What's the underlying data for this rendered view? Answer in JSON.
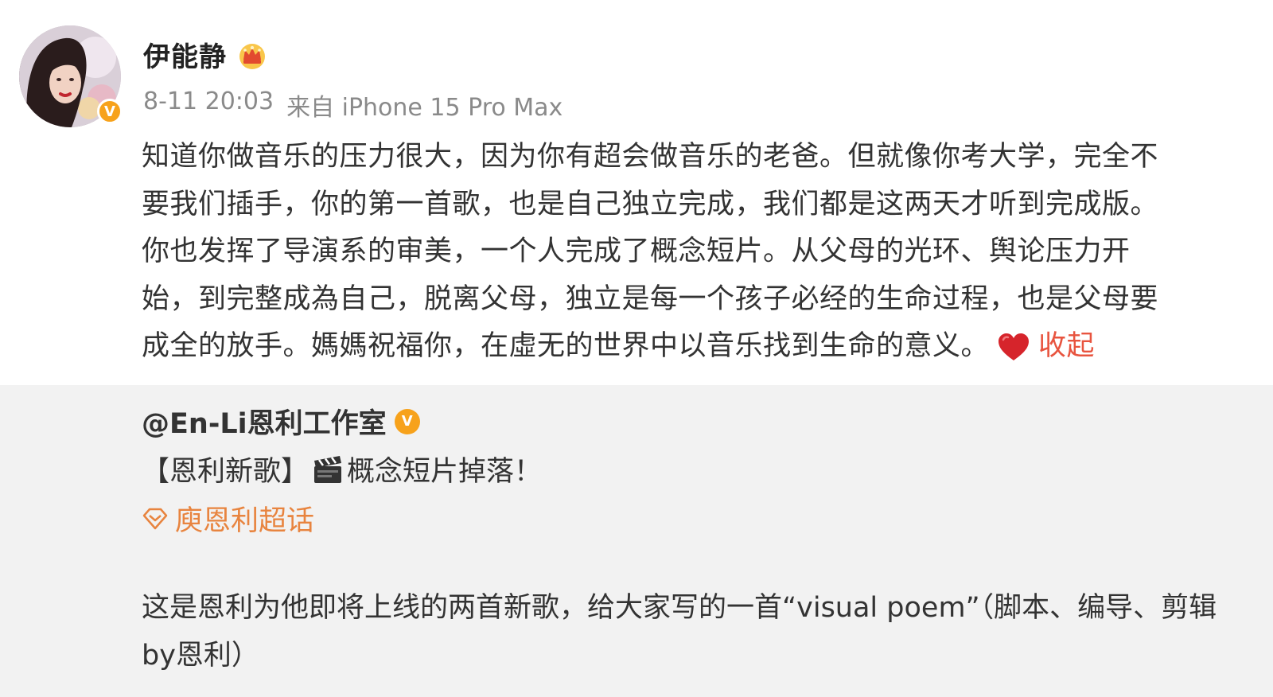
{
  "header": {
    "avatar_alt": "avatar",
    "username": "伊能静",
    "timestamp": "8-11 20:03",
    "source": "来自 iPhone 15 Pro Max",
    "verified_badge": "V"
  },
  "post": {
    "lines": [
      "知道你做音乐的压力很大，因为你有超会做音乐的老爸。但就像你考大学，完全不",
      "要我们插手，你的第一首歌，也是自己独立完成，我们都是这两天才听到完成版。",
      "你也发挥了导演系的审美，一个人完成了概念短片。从父母的光环、舆论压力开",
      "始，到完整成為自己，脱离父母，独立是每一个孩子必经的生命过程，也是父母要",
      "成全的放手。媽媽祝福你，在虛无的世界中以音乐找到生命的意义。"
    ],
    "collapse_label": "收起"
  },
  "repost": {
    "author": "@En-Li恩利工作室",
    "verified_badge": "V",
    "title_prefix": "【恩利新歌】",
    "title_suffix": "概念短片掉落！",
    "topic": "庾恩利超话",
    "body_lines": [
      "这是恩利为他即将上线的两首新歌，给大家写的一首“visual poem”（脚本、编导、剪辑",
      "by恩利）"
    ]
  },
  "colors": {
    "accent_orange": "#f7a21b",
    "link_red": "#e8543f",
    "topic_orange": "#e8843f",
    "repost_bg": "#f2f2f2"
  },
  "icons": {
    "crown": "crown-icon",
    "heart": "heart-icon",
    "clapper": "clapperboard-icon",
    "topic": "super-topic-icon"
  }
}
